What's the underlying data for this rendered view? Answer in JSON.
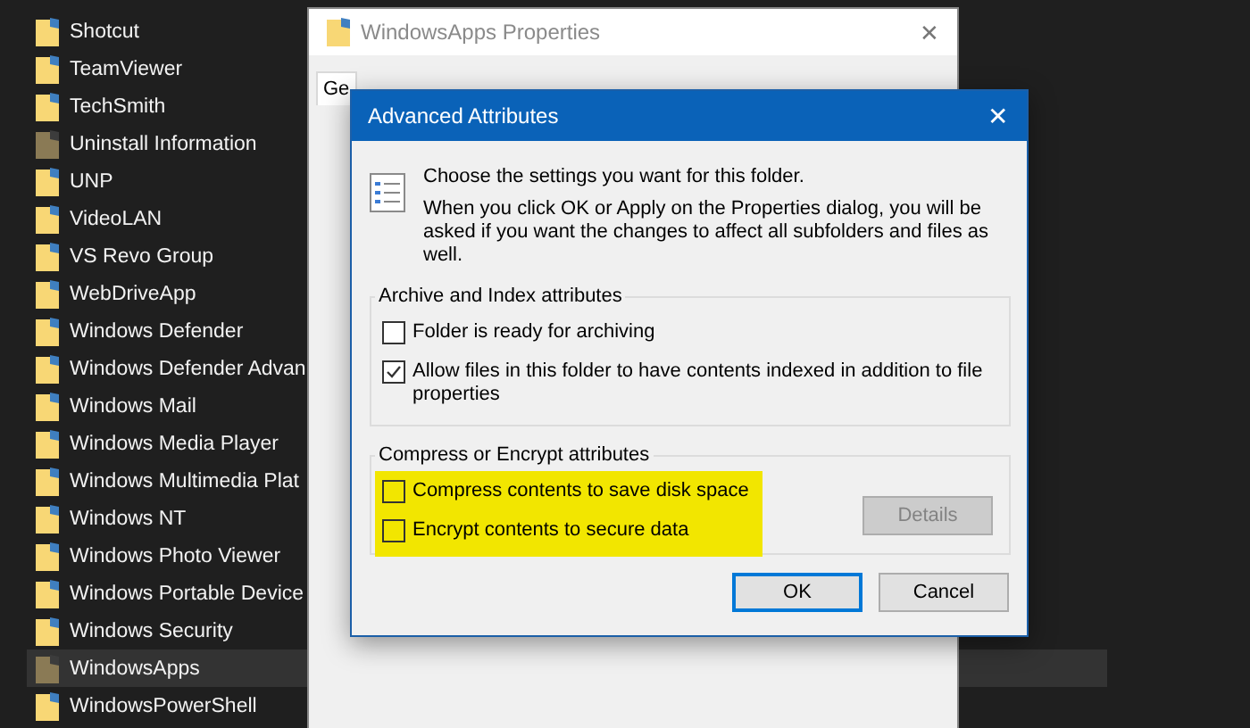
{
  "explorer": {
    "items": [
      {
        "name": "Shotcut",
        "hidden": false,
        "selected": false
      },
      {
        "name": "TeamViewer",
        "hidden": false,
        "selected": false
      },
      {
        "name": "TechSmith",
        "hidden": false,
        "selected": false
      },
      {
        "name": "Uninstall Information",
        "hidden": true,
        "selected": false
      },
      {
        "name": "UNP",
        "hidden": false,
        "selected": false
      },
      {
        "name": "VideoLAN",
        "hidden": false,
        "selected": false
      },
      {
        "name": "VS Revo Group",
        "hidden": false,
        "selected": false
      },
      {
        "name": "WebDriveApp",
        "hidden": false,
        "selected": false
      },
      {
        "name": "Windows Defender",
        "hidden": false,
        "selected": false
      },
      {
        "name": "Windows Defender Advan",
        "hidden": false,
        "selected": false
      },
      {
        "name": "Windows Mail",
        "hidden": false,
        "selected": false
      },
      {
        "name": "Windows Media Player",
        "hidden": false,
        "selected": false
      },
      {
        "name": "Windows Multimedia Plat",
        "hidden": false,
        "selected": false
      },
      {
        "name": "Windows NT",
        "hidden": false,
        "selected": false
      },
      {
        "name": "Windows Photo Viewer",
        "hidden": false,
        "selected": false
      },
      {
        "name": "Windows Portable Device",
        "hidden": false,
        "selected": false
      },
      {
        "name": "Windows Security",
        "hidden": false,
        "selected": false
      },
      {
        "name": "WindowsApps",
        "hidden": true,
        "selected": true
      },
      {
        "name": "WindowsPowerShell",
        "hidden": false,
        "selected": false
      }
    ]
  },
  "properties_window": {
    "title": "WindowsApps Properties",
    "close": "✕",
    "tabs": [
      {
        "label": "Ge",
        "selected": true
      }
    ]
  },
  "dialog": {
    "title": "Advanced Attributes",
    "close": "✕",
    "intro": "Choose the settings you want for this folder.",
    "description": "When you click OK or Apply on the Properties dialog, you will be asked if you want the changes to affect all subfolders and files as well.",
    "groups": [
      {
        "title": "Archive and Index attributes",
        "highlighted": false,
        "options": [
          {
            "label": "Folder is ready for archiving",
            "checked": false
          },
          {
            "label": "Allow files in this folder to have contents indexed in addition to file properties",
            "checked": true
          }
        ]
      },
      {
        "title": "Compress or Encrypt attributes",
        "highlighted": true,
        "options": [
          {
            "label": "Compress contents to save disk space",
            "checked": false
          },
          {
            "label": "Encrypt contents to secure data",
            "checked": false
          }
        ],
        "button": {
          "label": "Details",
          "disabled": true
        }
      }
    ],
    "buttons": [
      {
        "label": "OK",
        "default": true
      },
      {
        "label": "Cancel",
        "default": false
      }
    ]
  }
}
